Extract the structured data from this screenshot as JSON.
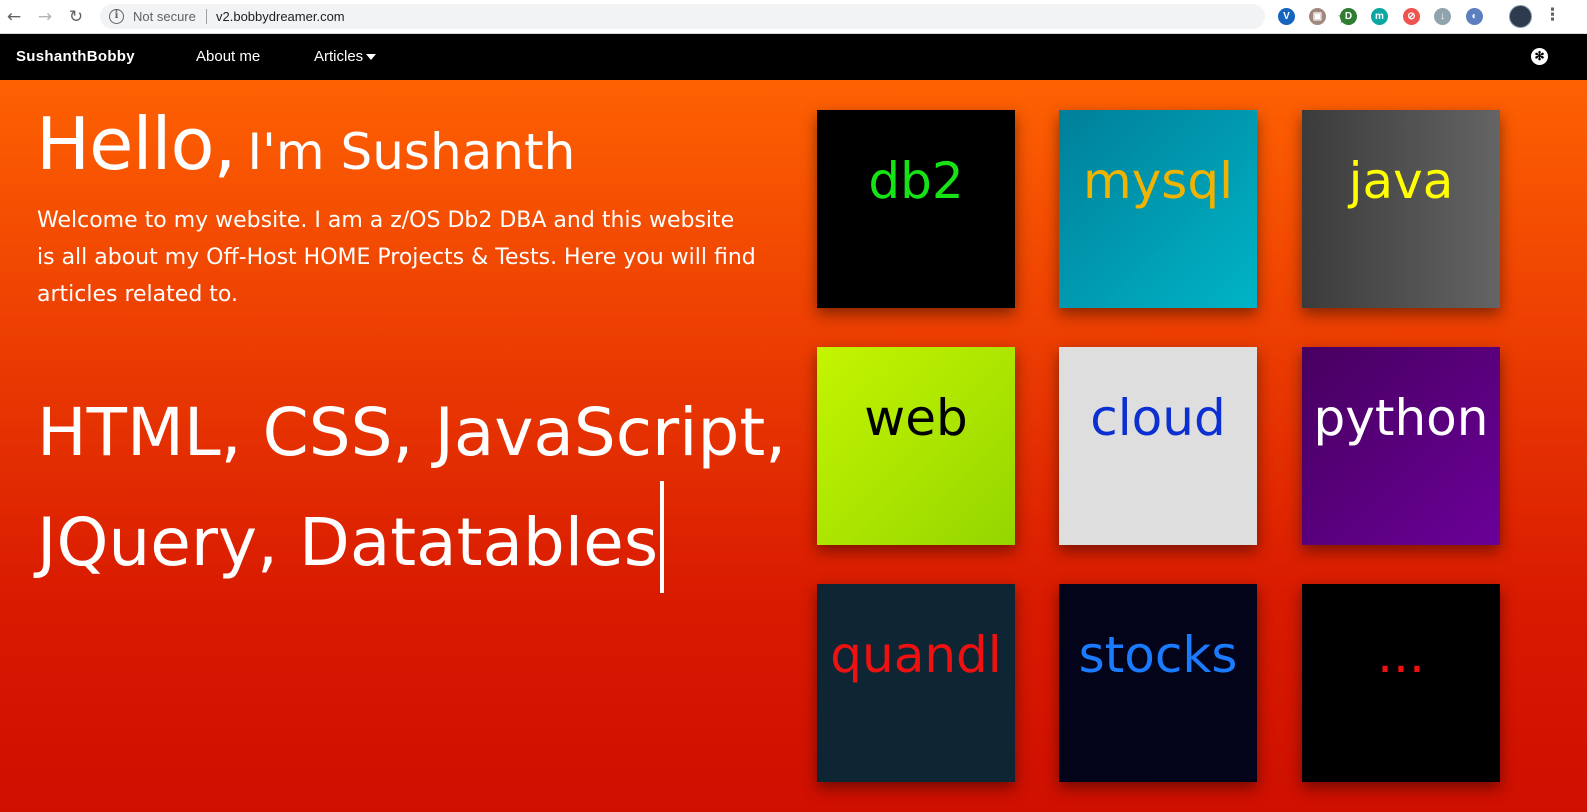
{
  "browser": {
    "back_icon": "arrow-left-icon",
    "forward_icon": "arrow-right-icon",
    "reload_icon": "reload-icon",
    "security_label": "Not secure",
    "url": "v2.bobbydreamer.com",
    "bookmark_icon": "star-icon",
    "extensions": [
      {
        "name": "vivaldi-ext-icon",
        "glyph": "V",
        "color": "#1565c0"
      },
      {
        "name": "printer-ext-icon",
        "glyph": "▣",
        "color": "#a1887f"
      },
      {
        "name": "pushbullet-ext-icon",
        "glyph": "D",
        "color": "#2e7d32"
      },
      {
        "name": "m-ext-icon",
        "glyph": "m",
        "color": "#0aa8a0"
      },
      {
        "name": "blocker-ext-icon",
        "glyph": "⊘",
        "color": "#ef5350"
      },
      {
        "name": "download-ext-icon",
        "glyph": "↓",
        "color": "#90a4ae"
      },
      {
        "name": "compass-ext-icon",
        "glyph": "◐",
        "color": "#5c7fbf"
      }
    ]
  },
  "navbar": {
    "brand": "SushanthBobby",
    "links": [
      "About me",
      "Articles"
    ],
    "gear_icon": "settings-icon"
  },
  "hero": {
    "hello": "Hello,",
    "name": "I'm Sushanth",
    "welcome": "Welcome to my website. I am a z/OS Db2 DBA and this website is all about my Off-Host HOME Projects & Tests. Here you will find articles related to.",
    "typed_line1": "HTML, CSS, JavaScript,",
    "typed_line2": "JQuery, Datatables"
  },
  "tiles": [
    {
      "label": "db2",
      "color": "#16e316",
      "bg": "#000000"
    },
    {
      "label": "mysql",
      "color": "#f0b400",
      "bg": "linear-gradient(135deg,#007f9a,#00b4c6)"
    },
    {
      "label": "java",
      "color": "#ffff00",
      "bg": "linear-gradient(90deg,#3b3b3b,#646464)"
    },
    {
      "label": "web",
      "color": "#000000",
      "bg": "linear-gradient(135deg,#c4f500,#95d600)"
    },
    {
      "label": "cloud",
      "color": "#0b2fd1",
      "bg": "#dedede"
    },
    {
      "label": "python",
      "color": "#ffffff",
      "bg": "linear-gradient(135deg,#47005f,#6a0098)"
    },
    {
      "label": "quandl",
      "color": "#ee1111",
      "bg": "#0e2533"
    },
    {
      "label": "stocks",
      "color": "#1a7bff",
      "bg": "#03031a"
    },
    {
      "label": "...",
      "color": "#ee1111",
      "bg": "#000000"
    }
  ]
}
